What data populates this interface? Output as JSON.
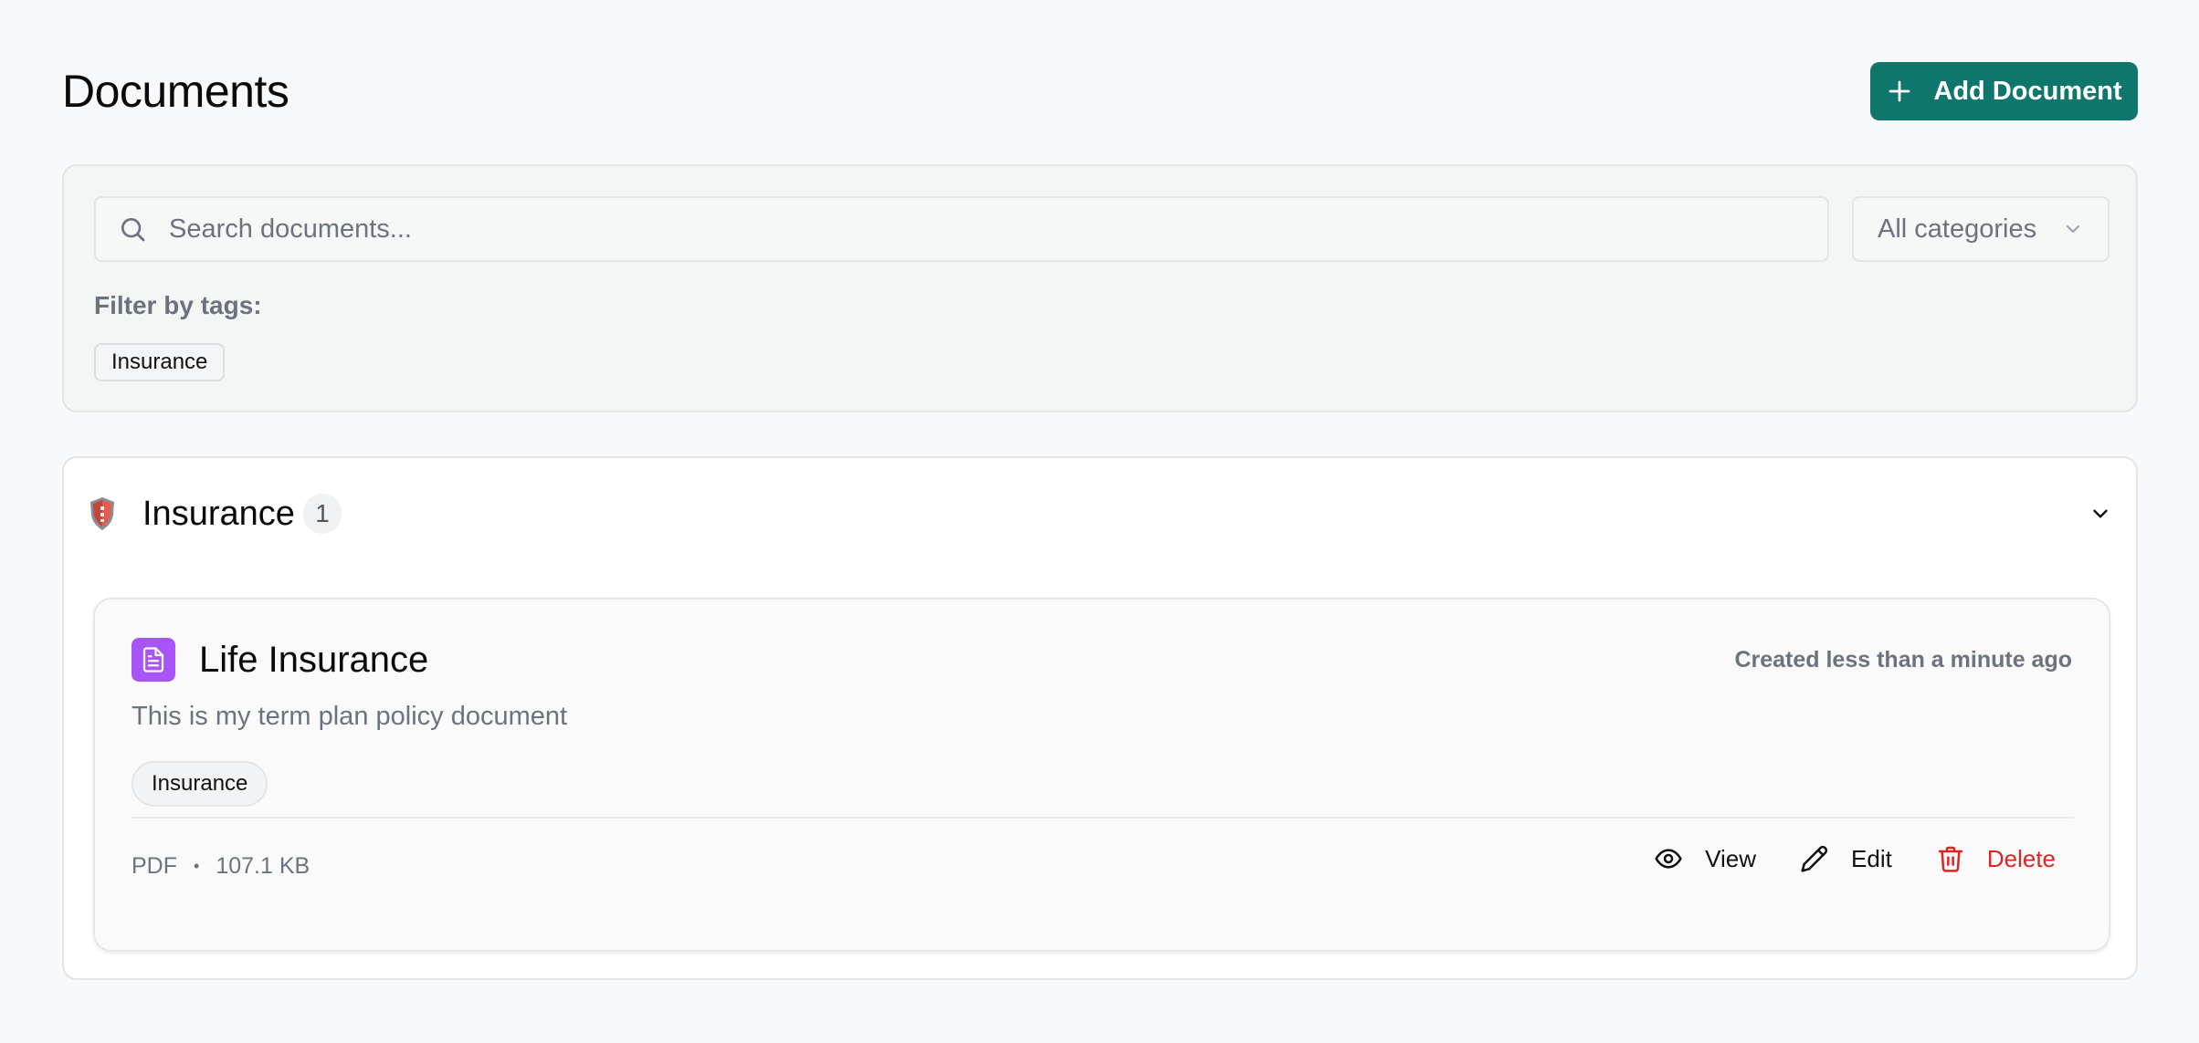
{
  "header": {
    "title": "Documents",
    "add_button_label": "Add Document"
  },
  "filters": {
    "search_placeholder": "Search documents...",
    "search_value": "",
    "category_selected": "All categories",
    "filter_label": "Filter by tags:",
    "tags": [
      "Insurance"
    ]
  },
  "group": {
    "title": "Insurance",
    "count": "1",
    "documents": [
      {
        "title": "Life Insurance",
        "created": "Created less than a minute ago",
        "description": "This is my term plan policy document",
        "tag": "Insurance",
        "file_type": "PDF",
        "separator": "•",
        "file_size": "107.1 KB",
        "actions": {
          "view": "View",
          "edit": "Edit",
          "delete": "Delete"
        }
      }
    ]
  },
  "colors": {
    "accent": "#0f766e",
    "doc_icon_bg": "#a855f7",
    "danger": "#dc2626",
    "muted_text": "#6b7280"
  },
  "icons": {
    "add": "plus-icon",
    "search": "search-icon",
    "select": "chevron-down-icon",
    "group": "shield-icon",
    "collapse": "chevron-down-icon",
    "document": "file-text-icon",
    "view": "eye-icon",
    "edit": "pencil-icon",
    "delete": "trash-icon"
  }
}
